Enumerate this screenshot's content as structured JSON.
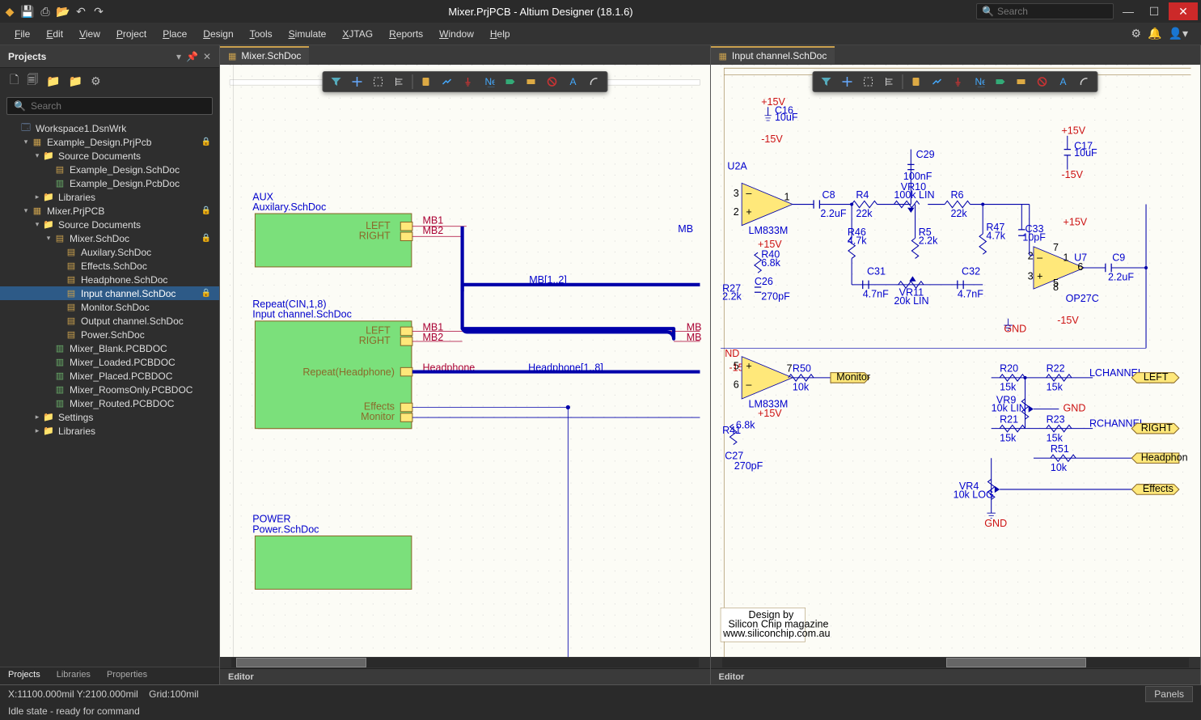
{
  "titlebar": {
    "title": "Mixer.PrjPCB - Altium Designer (18.1.6)",
    "search_placeholder": "Search"
  },
  "menubar": {
    "items": [
      "File",
      "Edit",
      "View",
      "Project",
      "Place",
      "Design",
      "Tools",
      "Simulate",
      "XJTAG",
      "Reports",
      "Window",
      "Help"
    ]
  },
  "sidebar": {
    "panel_title": "Projects",
    "search_placeholder": "Search",
    "tree": [
      {
        "d": 0,
        "exp": "",
        "icon": "wrk",
        "label": "Workspace1.DsnWrk",
        "lock": false
      },
      {
        "d": 1,
        "exp": "▾",
        "icon": "prj",
        "label": "Example_Design.PrjPcb",
        "lock": true
      },
      {
        "d": 2,
        "exp": "▾",
        "icon": "folder",
        "label": "Source Documents",
        "lock": false
      },
      {
        "d": 3,
        "exp": "",
        "icon": "doc",
        "label": "Example_Design.SchDoc",
        "lock": false
      },
      {
        "d": 3,
        "exp": "",
        "icon": "pcb",
        "label": "Example_Design.PcbDoc",
        "lock": false
      },
      {
        "d": 2,
        "exp": "▸",
        "icon": "folder",
        "label": "Libraries",
        "lock": false
      },
      {
        "d": 1,
        "exp": "▾",
        "icon": "prj",
        "label": "Mixer.PrjPCB",
        "lock": true
      },
      {
        "d": 2,
        "exp": "▾",
        "icon": "folder",
        "label": "Source Documents",
        "lock": false
      },
      {
        "d": 3,
        "exp": "▾",
        "icon": "doc",
        "label": "Mixer.SchDoc",
        "lock": true
      },
      {
        "d": 4,
        "exp": "",
        "icon": "doc",
        "label": "Auxilary.SchDoc",
        "lock": false
      },
      {
        "d": 4,
        "exp": "",
        "icon": "doc",
        "label": "Effects.SchDoc",
        "lock": false
      },
      {
        "d": 4,
        "exp": "",
        "icon": "doc",
        "label": "Headphone.SchDoc",
        "lock": false
      },
      {
        "d": 4,
        "exp": "",
        "icon": "doc",
        "label": "Input channel.SchDoc",
        "lock": true,
        "sel": true
      },
      {
        "d": 4,
        "exp": "",
        "icon": "doc",
        "label": "Monitor.SchDoc",
        "lock": false
      },
      {
        "d": 4,
        "exp": "",
        "icon": "doc",
        "label": "Output channel.SchDoc",
        "lock": false
      },
      {
        "d": 4,
        "exp": "",
        "icon": "doc",
        "label": "Power.SchDoc",
        "lock": false
      },
      {
        "d": 3,
        "exp": "",
        "icon": "pcb",
        "label": "Mixer_Blank.PCBDOC",
        "lock": false
      },
      {
        "d": 3,
        "exp": "",
        "icon": "pcb",
        "label": "Mixer_Loaded.PCBDOC",
        "lock": false
      },
      {
        "d": 3,
        "exp": "",
        "icon": "pcb",
        "label": "Mixer_Placed.PCBDOC",
        "lock": false
      },
      {
        "d": 3,
        "exp": "",
        "icon": "pcb",
        "label": "Mixer_RoomsOnly.PCBDOC",
        "lock": false
      },
      {
        "d": 3,
        "exp": "",
        "icon": "pcb",
        "label": "Mixer_Routed.PCBDOC",
        "lock": false
      },
      {
        "d": 2,
        "exp": "▸",
        "icon": "folder",
        "label": "Settings",
        "lock": false
      },
      {
        "d": 2,
        "exp": "▸",
        "icon": "folder",
        "label": "Libraries",
        "lock": false
      }
    ],
    "bottom_tabs": [
      "Projects",
      "Libraries",
      "Properties"
    ]
  },
  "editor1": {
    "tab": "Mixer.SchDoc",
    "footer": "Editor",
    "sheet_aux_title": "AUX",
    "sheet_aux_doc": "Auxilary.SchDoc",
    "sheet_cin_title": "Repeat(CIN,1,8)",
    "sheet_cin_doc": "Input channel.SchDoc",
    "sheet_power_title": "POWER",
    "sheet_power_doc": "Power.SchDoc",
    "labels": {
      "LEFT": "LEFT",
      "RIGHT": "RIGHT",
      "MB1": "MB1",
      "MB2": "MB2",
      "MB": "MB",
      "MB12": "MB[1..2]",
      "Headphone": "Headphone",
      "Headphone18": "Headphone[1..8]",
      "RepeatHeadphone": "Repeat(Headphone)",
      "Effects": "Effects",
      "Monitor": "Monitor"
    }
  },
  "editor2": {
    "tab": "Input channel.SchDoc",
    "footer": "Editor",
    "designations": {
      "U2A": "U2A",
      "LM833M": "LM833M",
      "U7": "U7",
      "OP27C": "OP27C",
      "C16": "C16",
      "C16v": "10uF",
      "C17": "C17",
      "C17v": "10uF",
      "C29": "C29",
      "C29v": "100nF",
      "C8": "C8",
      "C8v": "2.2uF",
      "C9": "C9",
      "C9v": "2.2uF",
      "C31": "C31",
      "C31v": "4.7nF",
      "C32": "C32",
      "C32v": "4.7nF",
      "C33": "C33",
      "C33v": "10pF",
      "C26": "C26",
      "C26v": "270pF",
      "C27": "C27",
      "C27v": "270pF",
      "R4": "R4",
      "R4v": "22k",
      "R6": "R6",
      "R6v": "22k",
      "R5": "R5",
      "R5v": "2.2k",
      "R46": "R46",
      "R46v": "4.7k",
      "R47": "R47",
      "R47v": "4.7k",
      "R40": "R40",
      "R40v": "6.8k",
      "R41": "R41",
      "R41v": "6.8k",
      "R27": "R27",
      "R27v": "2.2k",
      "R20": "R20",
      "R20v": "15k",
      "R22": "R22",
      "R22v": "15k",
      "R21": "R21",
      "R21v": "15k",
      "R23": "R23",
      "R23v": "15k",
      "R50": "R50",
      "R50v": "10k",
      "R51": "R51",
      "R51v": "10k",
      "VR10": "VR10",
      "VR10v": "100k LIN",
      "VR9": "VR9",
      "VR9v": "10k LIN",
      "VR11": "VR11",
      "VR11v": "20k LIN",
      "VR4": "VR4",
      "VR4v": "10k LOG",
      "p15v": "+15V",
      "m15v": "-15V",
      "GND": "GND",
      "Monitor": "Monitor",
      "LCHANNEL": "LCHANNEL",
      "LEFT": "LEFT",
      "RCHANNEL": "RCHANNEL",
      "RIGHT": "RIGHT",
      "Headphone": "Headphon",
      "Effects": "Effects",
      "designby": "Design by",
      "sc": "Silicon Chip magazine",
      "url": "www.siliconchip.com.au"
    }
  },
  "statusbar": {
    "coords": "X:11100.000mil Y:2100.000mil",
    "grid": "Grid:100mil",
    "idle": "Idle state - ready for command",
    "panels": "Panels"
  }
}
